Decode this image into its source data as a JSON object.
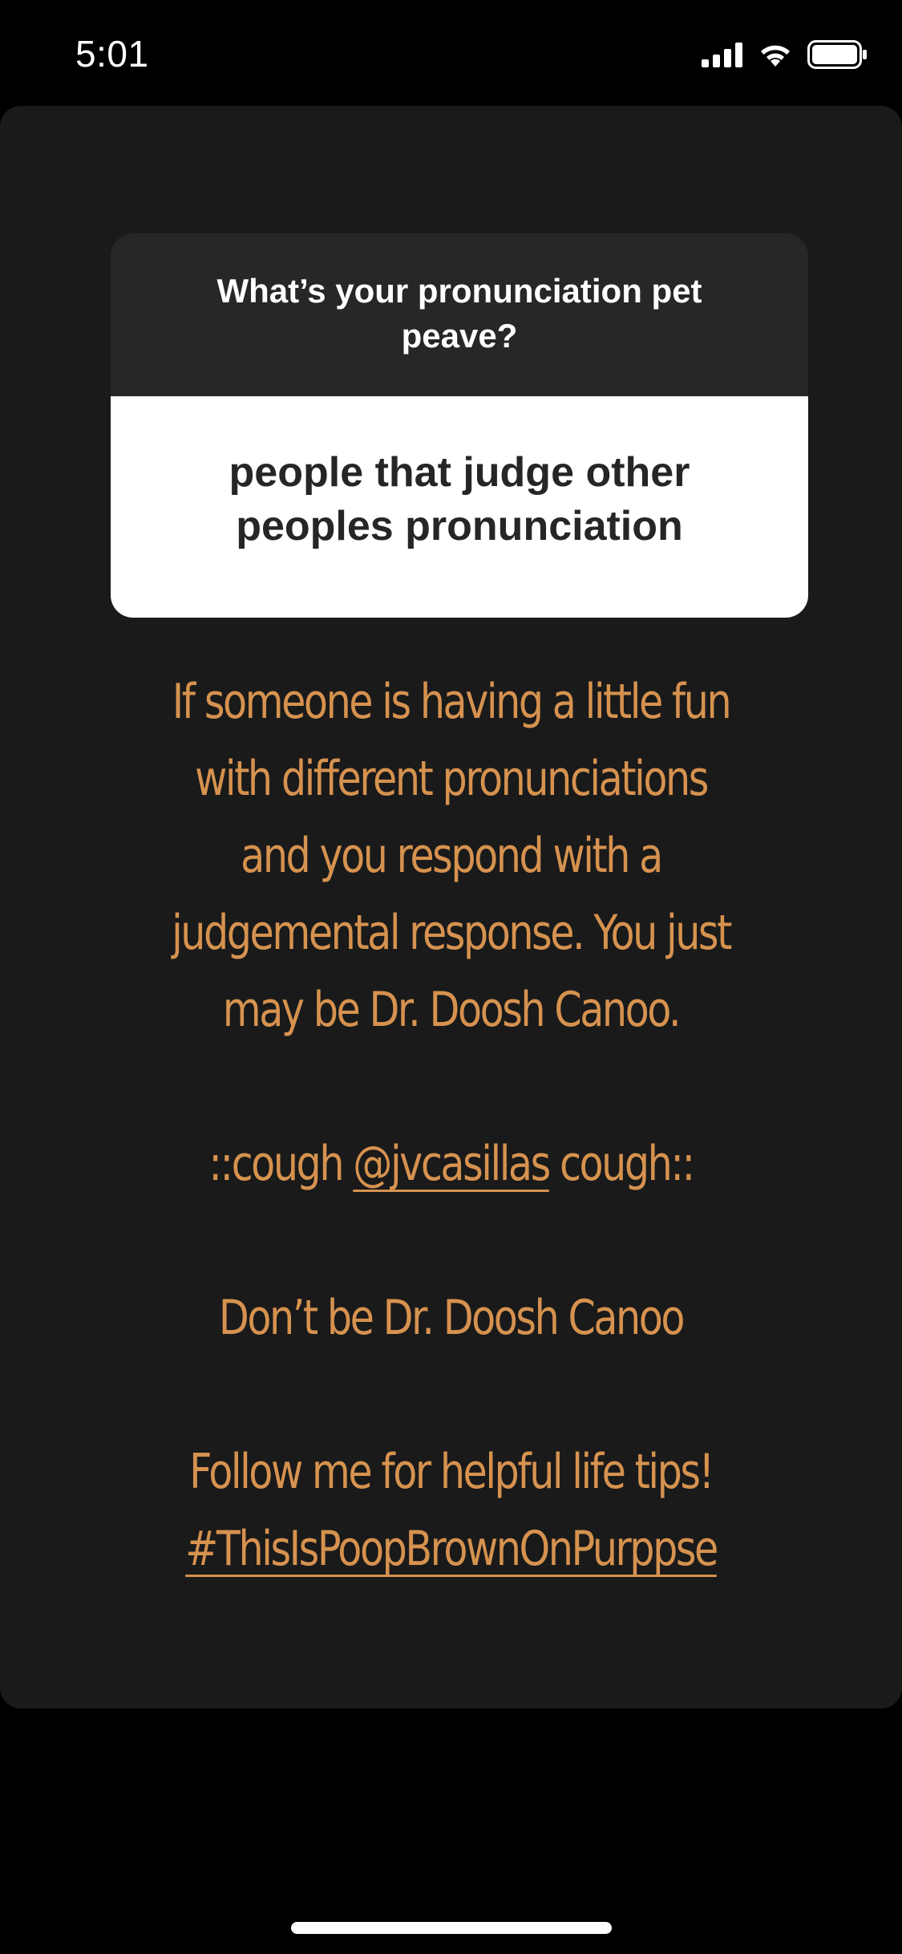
{
  "status_bar": {
    "time": "5:01",
    "icons": [
      "cellular-signal-icon",
      "wifi-icon",
      "battery-icon"
    ]
  },
  "question_sticker": {
    "question": "What’s your pronunciation pet peave?",
    "answer": "people that judge other peoples pronunciation"
  },
  "caption": {
    "paragraph_1_lines": [
      "If someone is having a little fun",
      "with different pronunciations",
      "and you respond with a",
      "judgemental response. You just",
      "may be Dr. Doosh Canoo."
    ],
    "cough_prefix": "::cough ",
    "mention": "@jvcasillas",
    "cough_suffix": " cough::",
    "line_dont": "Don’t be Dr. Doosh Canoo",
    "line_follow": "Follow me for helpful life tips!",
    "hashtag": "#ThisIsPoopBrownOnPurppse"
  },
  "colors": {
    "background": "#000000",
    "card": "#1a1a1a",
    "question_header": "#272727",
    "caption_text": "#d6924f"
  }
}
